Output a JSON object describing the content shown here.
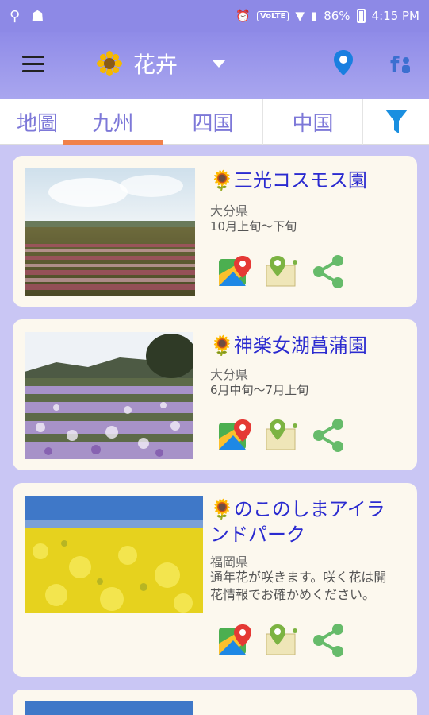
{
  "status": {
    "battery": "86%",
    "time": "4:15 PM",
    "volte": "VoLTE"
  },
  "header": {
    "title": "花卉",
    "title_icon": "sunflower-icon"
  },
  "tabs": [
    {
      "label": "地圖"
    },
    {
      "label": "九州",
      "active": true
    },
    {
      "label": "四国"
    },
    {
      "label": "中国"
    }
  ],
  "cards": [
    {
      "title": "三光コスモス園",
      "prefecture": "大分県",
      "period": "10月上旬～下旬"
    },
    {
      "title": "神楽女湖菖蒲園",
      "prefecture": "大分県",
      "period": "6月中旬～7月上旬"
    },
    {
      "title_line1": "のこのしまアイラ",
      "title_line2": "ンドパーク",
      "prefecture": "福岡県",
      "note_line1": "通年花が咲きます。咲く花は開",
      "note_line2": "花情報でお確かめください。"
    }
  ],
  "colors": {
    "accent": "#f0814a",
    "title_blue": "#2b2bd0",
    "tab_text": "#7d78d8",
    "card_bg": "#fcf8ee"
  }
}
